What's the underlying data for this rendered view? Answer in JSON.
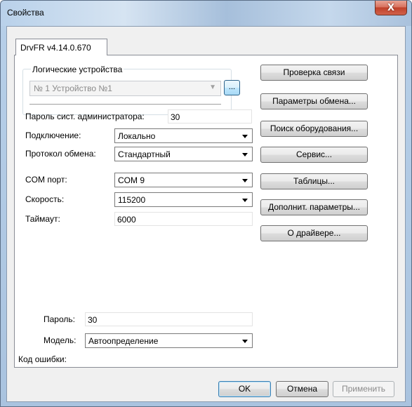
{
  "window": {
    "title": "Свойства",
    "close_glyph": "X"
  },
  "tab": {
    "label": "DrvFR v4.14.0.670"
  },
  "logical_devices": {
    "group_label": "Логические устройства",
    "selected": "№ 1 Устройство №1",
    "browse_label": "..."
  },
  "admin_password": {
    "label": "Пароль сист. администратора:",
    "value": "30"
  },
  "connection": {
    "label": "Подключение:",
    "value": "Локально"
  },
  "protocol": {
    "label": "Протокол обмена:",
    "value": "Стандартный"
  },
  "com_port": {
    "label": "COM порт:",
    "value": "COM 9"
  },
  "speed": {
    "label": "Скорость:",
    "value": "115200"
  },
  "timeout": {
    "label": "Таймаут:",
    "value": "6000"
  },
  "password": {
    "label": "Пароль:",
    "value": "30"
  },
  "model": {
    "label": "Модель:",
    "value": "Автоопределение"
  },
  "error_code": {
    "label": "Код ошибки:"
  },
  "side_buttons": {
    "check_connection": "Проверка связи",
    "exchange_params": "Параметры обмена...",
    "search_equipment": "Поиск оборудования...",
    "service": "Сервис...",
    "tables": "Таблицы...",
    "extra_params": "Дополнит. параметры...",
    "about": "О драйвере..."
  },
  "dialog_buttons": {
    "ok": "OK",
    "cancel": "Отмена",
    "apply": "Применить"
  }
}
